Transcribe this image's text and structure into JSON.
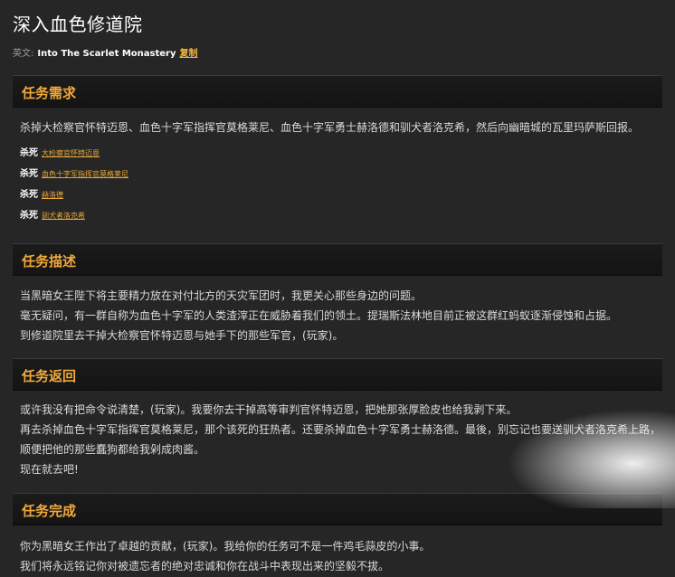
{
  "title": "深入血色修道院",
  "english": {
    "label": "英文:",
    "name": "Into The Scarlet Monastery",
    "copy": "复制"
  },
  "sections": {
    "requirements": {
      "header": "任务需求",
      "summary": "杀掉大检察官怀特迈恩、血色十字军指挥官莫格莱尼、血色十字军勇士赫洛德和驯犬者洛克希，然后向幽暗城的瓦里玛萨斯回报。",
      "kill_label": "杀死",
      "targets": [
        "大检察官怀特迈恩",
        "血色十字军指挥官莫格莱尼",
        "赫洛德",
        "驯犬者洛克希"
      ]
    },
    "description": {
      "header": "任务描述",
      "lines": [
        "当黑暗女王陛下将主要精力放在对付北方的天灾军团时，我更关心那些身边的问题。",
        "毫无疑问，有一群自称为血色十字军的人类渣滓正在威胁着我们的领土。提瑞斯法林地目前正被这群红蚂蚁逐渐侵蚀和占据。",
        "到修道院里去干掉大检察官怀特迈恩与她手下的那些军官，(玩家)。"
      ]
    },
    "return": {
      "header": "任务返回",
      "lines": [
        "或许我没有把命令说清楚，(玩家)。我要你去干掉高等审判官怀特迈恩，把她那张厚脸皮也给我剥下来。",
        "再去杀掉血色十字军指挥官莫格莱尼，那个该死的狂热者。还要杀掉血色十字军勇士赫洛德。最後，别忘记也要送驯犬者洛克希上路，",
        "顺便把他的那些蠢狗都给我剁成肉酱。",
        "现在就去吧!"
      ]
    },
    "complete": {
      "header": "任务完成",
      "lines": [
        "你为黑暗女王作出了卓越的贡献，(玩家)。我给你的任务可不是一件鸡毛蒜皮的小事。",
        "我们将永远铭记你对被遗忘者的绝对忠诚和你在战斗中表现出来的坚毅不拔。"
      ]
    }
  }
}
